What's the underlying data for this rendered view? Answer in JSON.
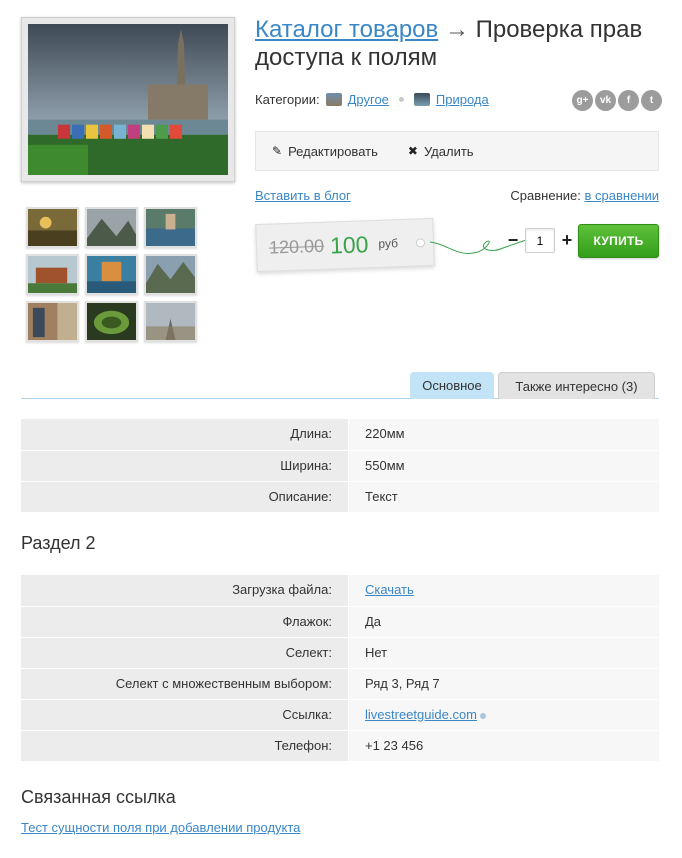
{
  "product": {
    "breadcrumb_link": "Каталог товаров",
    "arrow": "→",
    "title": "Проверка прав доступа к полям"
  },
  "categories": {
    "label": "Категории:",
    "items": [
      {
        "label": "Другое",
        "icon": "category-image-icon"
      },
      {
        "label": "Природа",
        "icon": "category-image-icon"
      }
    ]
  },
  "social": [
    "g+",
    "vk",
    "f",
    "t"
  ],
  "actions": {
    "edit_label": "Редактировать",
    "delete_label": "Удалить"
  },
  "blog_link": "Вставить в блог",
  "compare": {
    "label": "Сравнение:",
    "link": "в сравнении"
  },
  "price": {
    "old": "120.00",
    "new": "100",
    "currency": "руб"
  },
  "quantity": {
    "minus": "−",
    "value": "1",
    "plus": "+"
  },
  "buy_label": "КУПИТЬ",
  "tabs": [
    {
      "label": "Основное",
      "active": true
    },
    {
      "label": "Также интересно (3)",
      "active": false
    }
  ],
  "props_main": [
    {
      "key": "Длина:",
      "value": "220мм"
    },
    {
      "key": "Ширина:",
      "value": "550мм"
    },
    {
      "key": "Описание:",
      "value": "Текст"
    }
  ],
  "section2_title": "Раздел 2",
  "props_section2": [
    {
      "key": "Загрузка файла:",
      "value": "Скачать"
    },
    {
      "key": "Флажок:",
      "value": "Да"
    },
    {
      "key": "Селект:",
      "value": "Нет"
    },
    {
      "key": "Селект с множественным выбором:",
      "value": "Ряд 3, Ряд 7"
    },
    {
      "key": "Ссылка:",
      "value": "livestreetguide.com"
    },
    {
      "key": "Телефон:",
      "value": "+1 23 456"
    }
  ],
  "related": {
    "title": "Связанная ссылка",
    "link": "Тест сущности поля при добавлении продукта"
  },
  "colors": {
    "link": "#3a87c8",
    "price_green": "#3aa34a",
    "buy_button": "#4cb42a",
    "tab_active": "#c3e3f7"
  }
}
